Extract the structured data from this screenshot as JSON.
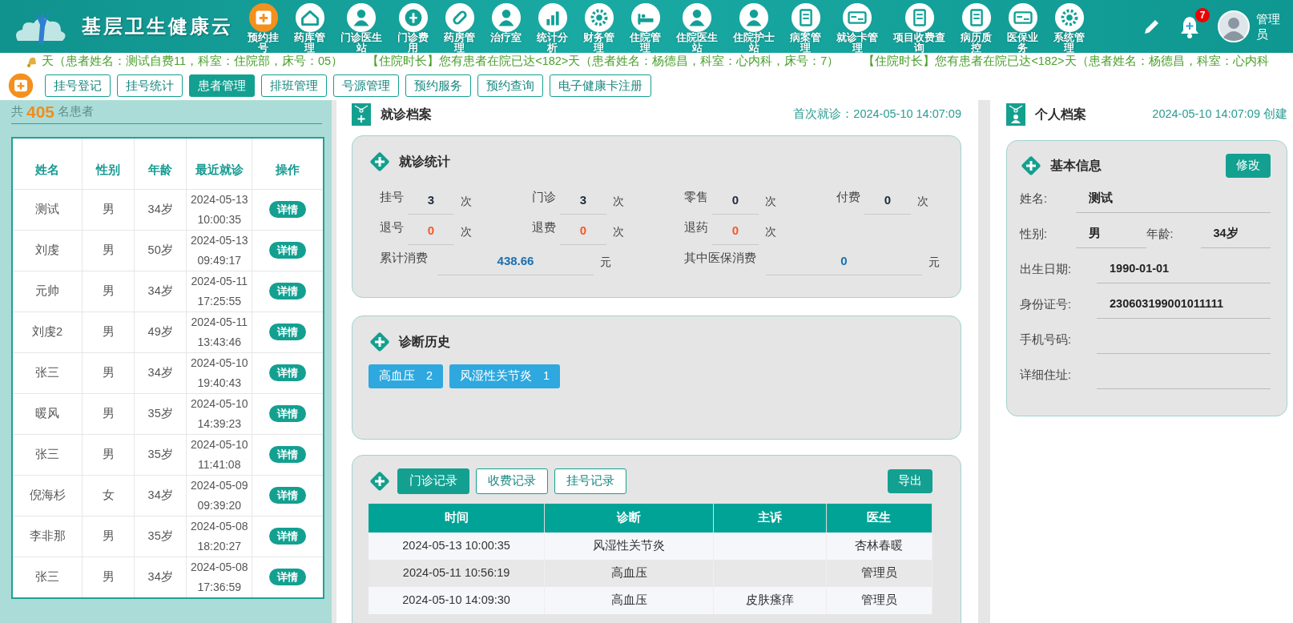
{
  "header": {
    "title": "基层卫生健康云",
    "nav": [
      {
        "label": "预约挂号"
      },
      {
        "label": "药库管理"
      },
      {
        "label": "门诊医生站"
      },
      {
        "label": "门诊费用"
      },
      {
        "label": "药房管理"
      },
      {
        "label": "治疗室"
      },
      {
        "label": "统计分析"
      },
      {
        "label": "财务管理"
      },
      {
        "label": "住院管理"
      },
      {
        "label": "住院医生站"
      },
      {
        "label": "住院护士站"
      },
      {
        "label": "病案管理"
      },
      {
        "label": "就诊卡管理"
      },
      {
        "label": "项目收费查询"
      },
      {
        "label": "病历质控"
      },
      {
        "label": "医保业务"
      },
      {
        "label": "系统管理"
      }
    ],
    "notification_count": "7",
    "user": "管理员"
  },
  "alerts": [
    "天（患者姓名：测试自费11，科室：住院部，床号：05）",
    "【住院时长】您有患者在院已达<182>天（患者姓名：杨德昌，科室：心内科，床号：7）",
    "【住院时长】您有患者在院已达<182>天（患者姓名：杨德昌，科室：心内科"
  ],
  "tabs": [
    {
      "label": "挂号登记",
      "selected": false
    },
    {
      "label": "挂号统计",
      "selected": false
    },
    {
      "label": "患者管理",
      "selected": true
    },
    {
      "label": "排班管理",
      "selected": false
    },
    {
      "label": "号源管理",
      "selected": false
    },
    {
      "label": "预约服务",
      "selected": false
    },
    {
      "label": "预约查询",
      "selected": false
    },
    {
      "label": "电子健康卡注册",
      "selected": false
    }
  ],
  "patients": {
    "prefix": "共",
    "total": "405",
    "suffix": "名患者",
    "columns": [
      "姓名",
      "性别",
      "年龄",
      "最近就诊",
      "操作"
    ],
    "rows": [
      {
        "name": "测试",
        "sex": "男",
        "age": "34岁",
        "last_visit": "2024-05-13 10:00:35",
        "action": "详情"
      },
      {
        "name": "刘虔",
        "sex": "男",
        "age": "50岁",
        "last_visit": "2024-05-13 09:49:17",
        "action": "详情"
      },
      {
        "name": "元帅",
        "sex": "男",
        "age": "34岁",
        "last_visit": "2024-05-11 17:25:55",
        "action": "详情"
      },
      {
        "name": "刘虔2",
        "sex": "男",
        "age": "49岁",
        "last_visit": "2024-05-11 13:43:46",
        "action": "详情"
      },
      {
        "name": "张三",
        "sex": "男",
        "age": "34岁",
        "last_visit": "2024-05-10 19:40:43",
        "action": "详情"
      },
      {
        "name": "暖风",
        "sex": "男",
        "age": "35岁",
        "last_visit": "2024-05-10 14:39:23",
        "action": "详情"
      },
      {
        "name": "张三",
        "sex": "男",
        "age": "35岁",
        "last_visit": "2024-05-10 11:41:08",
        "action": "详情"
      },
      {
        "name": "倪海杉",
        "sex": "女",
        "age": "34岁",
        "last_visit": "2024-05-09 09:39:20",
        "action": "详情"
      },
      {
        "name": "李非那",
        "sex": "男",
        "age": "35岁",
        "last_visit": "2024-05-08 18:20:27",
        "action": "详情"
      },
      {
        "name": "张三",
        "sex": "男",
        "age": "34岁",
        "last_visit": "2024-05-08 17:36:59",
        "action": "详情"
      }
    ]
  },
  "visit_record": {
    "title": "就诊档案",
    "first_visit": "首次就诊：2024-05-10 14:07:09",
    "stats": {
      "title": "就诊统计",
      "items": [
        {
          "kind": "count",
          "label": "挂号",
          "value": "3",
          "unit": "次",
          "color": "#1e2a3c"
        },
        {
          "kind": "count",
          "label": "门诊",
          "value": "3",
          "unit": "次",
          "color": "#1e2a3c"
        },
        {
          "kind": "count",
          "label": "零售",
          "value": "0",
          "unit": "次",
          "color": "#1e2a3c"
        },
        {
          "kind": "count",
          "label": "付费",
          "value": "0",
          "unit": "次",
          "color": "#1e2a3c"
        },
        {
          "kind": "count",
          "label": "退号",
          "value": "0",
          "unit": "次",
          "color": "#f05a28"
        },
        {
          "kind": "count",
          "label": "退费",
          "value": "0",
          "unit": "次",
          "color": "#f05a28"
        },
        {
          "kind": "count",
          "label": "退药",
          "value": "0",
          "unit": "次",
          "color": "#f05a28"
        },
        {
          "kind": "amount",
          "label": "累计消费",
          "value": "438.66",
          "unit": "元",
          "color": "#1a6fb0"
        },
        {
          "kind": "amount",
          "label": "其中医保消费",
          "value": "0",
          "unit": "元",
          "color": "#1a6fb0"
        }
      ]
    },
    "diagnoses": {
      "title": "诊断历史",
      "tags": [
        {
          "label": "高血压",
          "count": "2"
        },
        {
          "label": "风湿性关节炎",
          "count": "1"
        }
      ]
    },
    "records": {
      "tabs": [
        {
          "label": "门诊记录",
          "selected": true
        },
        {
          "label": "收费记录",
          "selected": false
        },
        {
          "label": "挂号记录",
          "selected": false
        }
      ],
      "export": "导出",
      "columns": [
        "时间",
        "诊断",
        "主诉",
        "医生"
      ],
      "rows": [
        [
          "2024-05-13 10:00:35",
          "风湿性关节炎",
          "",
          "杏林春暖"
        ],
        [
          "2024-05-11 10:56:19",
          "高血压",
          "",
          "管理员"
        ],
        [
          "2024-05-10 14:09:30",
          "高血压",
          "皮肤瘙痒",
          "管理员"
        ]
      ]
    }
  },
  "profile": {
    "title": "个人档案",
    "created": "2024-05-10 14:07:09 创建",
    "card_title": "基本信息",
    "edit": "修改",
    "fields": [
      {
        "kind": "wide",
        "label": "姓名:",
        "value": "测试"
      },
      {
        "kind": "half",
        "label": "性别:",
        "value": "男"
      },
      {
        "kind": "half",
        "label": "年龄:",
        "value": "34岁"
      },
      {
        "kind": "wide",
        "label": "出生日期:",
        "value": "1990-01-01"
      },
      {
        "kind": "wide",
        "label": "身份证号:",
        "value": "230603199001011111"
      },
      {
        "kind": "wide",
        "label": "手机号码:"
      },
      {
        "kind": "wide",
        "label": "详细住址:"
      }
    ]
  }
}
